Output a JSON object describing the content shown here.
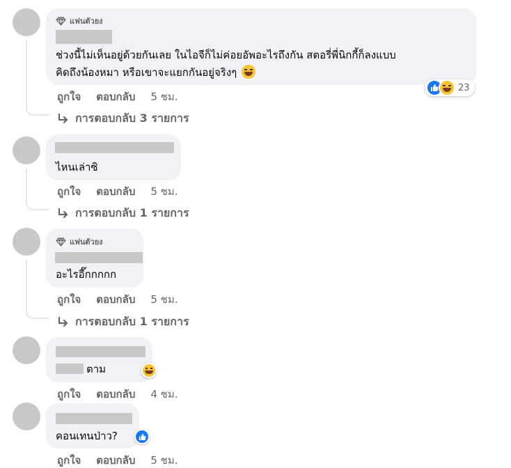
{
  "comments": [
    {
      "badge": "แฟนตัวยง",
      "text": "ช่วงนี้ไม่เห็นอยู่ด้วยกันเลย ในไอจีก็ไม่ค่อยอัพอะไรถึงกัน สตอรี่พี่นิกกี้ก็ลงแบบ",
      "text_line2": "คิดถึงน้องหมา หรือเขาจะแยกกันอยู่จริงๆ",
      "reaction_count": "23",
      "like_label": "ถูกใจ",
      "reply_label": "ตอบกลับ",
      "time": "5 ชม.",
      "replies": "การตอบกลับ 3 รายการ"
    },
    {
      "text": "ไหนเล่าซิ",
      "like_label": "ถูกใจ",
      "reply_label": "ตอบกลับ",
      "time": "5 ชม.",
      "replies": "การตอบกลับ 1 รายการ"
    },
    {
      "badge": "แฟนตัวยง",
      "text": "อะไรอี๊กกกกก",
      "like_label": "ถูกใจ",
      "reply_label": "ตอบกลับ",
      "time": "5 ชม.",
      "replies": "การตอบกลับ 1 รายการ"
    },
    {
      "text": "ตาม",
      "like_label": "ถูกใจ",
      "reply_label": "ตอบกลับ",
      "time": "4 ชม."
    },
    {
      "text": "คอนเทนป่าว?",
      "like_label": "ถูกใจ",
      "reply_label": "ตอบกลับ",
      "time": "5 ชม."
    }
  ]
}
